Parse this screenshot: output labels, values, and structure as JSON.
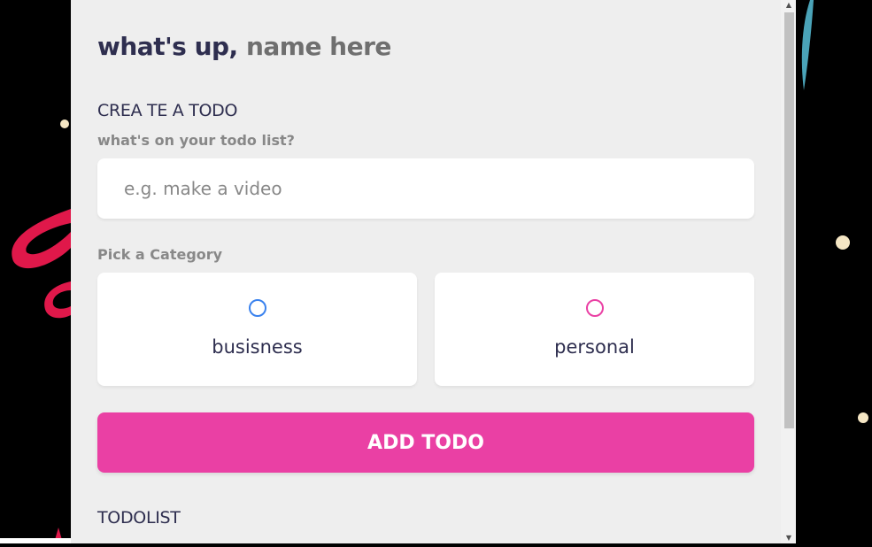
{
  "header": {
    "greeting": "what's up,",
    "name_placeholder": "name here"
  },
  "create": {
    "section_title": "CREA TE A TODO",
    "question_label": "what's on your todo list?",
    "input_placeholder": "e.g. make a video",
    "input_value": "",
    "category_label": "Pick a Category",
    "categories": [
      {
        "label": "busisness",
        "color": "#3a82ee",
        "selected": false
      },
      {
        "label": "personal",
        "color": "#ea40a4",
        "selected": false
      }
    ],
    "add_button_label": "ADD TODO",
    "add_button_color": "#ea40a4"
  },
  "todolist": {
    "section_title": "TODOLIST"
  },
  "colors": {
    "panel_background": "#eeeeee",
    "page_background": "#000000",
    "heading_dark": "#2e2e4f",
    "muted_text": "#888888"
  }
}
